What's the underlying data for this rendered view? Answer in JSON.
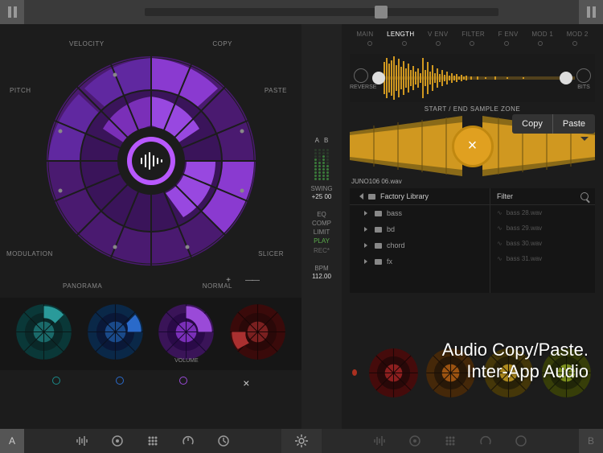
{
  "pad_labels": {
    "velocity": "VELOCITY",
    "copy": "COPY",
    "paste": "PASTE",
    "pitch": "PITCH",
    "modulation": "MODULATION",
    "panorama": "PANORAMA",
    "slicer": "SLICER",
    "normal": "NORMAL"
  },
  "mini_pads": {
    "volume_label": "VOLUME"
  },
  "center": {
    "a": "A",
    "b": "B",
    "swing_label": "SWING",
    "swing_val": "+25",
    "swing_steps": "00",
    "eq": "EQ",
    "comp": "COMP",
    "limit": "LIMIT",
    "play": "PLAY",
    "rec": "REC*",
    "bpm_label": "BPM",
    "bpm_val": "112.00"
  },
  "tabs": [
    "MAIN",
    "LENGTH",
    "V ENV",
    "FILTER",
    "F ENV",
    "MOD 1",
    "MOD 2"
  ],
  "active_tab_index": 1,
  "wf": {
    "reverse": "REVERSE",
    "bits": "BITS",
    "zone_label": "START / END SAMPLE ZONE"
  },
  "copy_paste": {
    "copy": "Copy",
    "paste": "Paste"
  },
  "filename": "JUNO106 06.wav",
  "browser": {
    "root": "Factory Library",
    "folders": [
      "bass",
      "bd",
      "chord",
      "fx"
    ],
    "filter_label": "Filter",
    "files": [
      "bass 28.wav",
      "bass 29.wav",
      "bass 30.wav",
      "bass 31.wav"
    ]
  },
  "overlay": {
    "line1": "Audio Copy/Paste.",
    "line2": "Inter-App Audio"
  },
  "bottom": {
    "a": "A",
    "b": "B"
  },
  "colors": {
    "purple": "#7a2fb8",
    "purple_dark": "#4a1a70",
    "purple_mid": "#6028a0",
    "teal": "#1a6a6a",
    "blue": "#1a4a8a",
    "red": "#7a2020",
    "gold": "#d09820",
    "gold_dark": "#8a6a18"
  }
}
